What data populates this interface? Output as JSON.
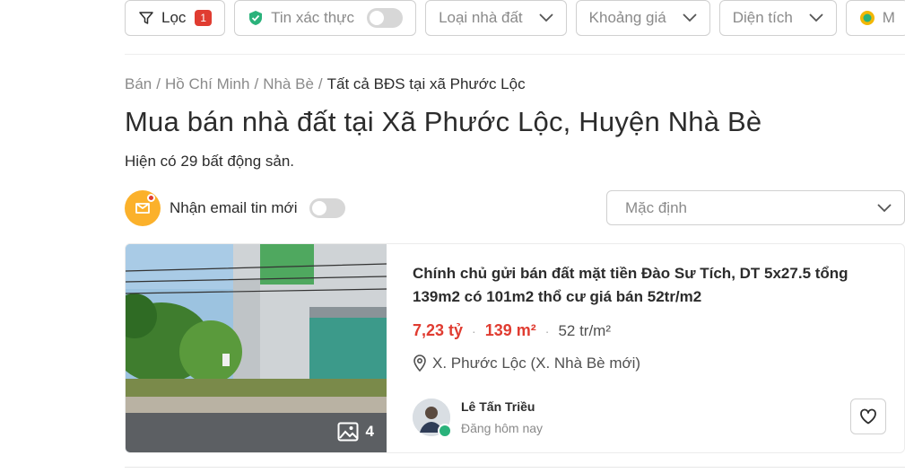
{
  "filters": {
    "filter_label": "Lọc",
    "filter_count": "1",
    "verified_label": "Tin xác thực",
    "property_type": "Loại nhà đất",
    "price_range": "Khoảng giá",
    "area": "Diện tích",
    "partial_label": "M"
  },
  "breadcrumb": {
    "items": [
      "Bán",
      "Hồ Chí Minh",
      "Nhà Bè"
    ],
    "current": "Tất cả BĐS tại xã Phước Lộc",
    "separator": "/"
  },
  "heading": "Mua bán nhà đất tại Xã Phước Lộc, Huyện Nhà Bè",
  "count_text": "Hiện có 29 bất động sản.",
  "email_alert": {
    "label": "Nhận email tin mới"
  },
  "sort": {
    "selected": "Mặc định"
  },
  "listing": {
    "title": "Chính chủ gửi bán đất mặt tiền Đào Sư Tích, DT 5x27.5 tổng 139m2 có 101m2 thổ cư giá bán 52tr/m2",
    "price": "7,23 tỷ",
    "area": "139 m²",
    "price_per_m2": "52 tr/m²",
    "location": "X. Phước Lộc (X. Nhà Bè mới)",
    "photo_count": "4",
    "agent_name": "Lê Tấn Triều",
    "posted": "Đăng hôm nay",
    "separator": "·"
  },
  "colors": {
    "accent": "#e03c31",
    "verified": "#2ab27b",
    "email_icon": "#fbb12b"
  }
}
